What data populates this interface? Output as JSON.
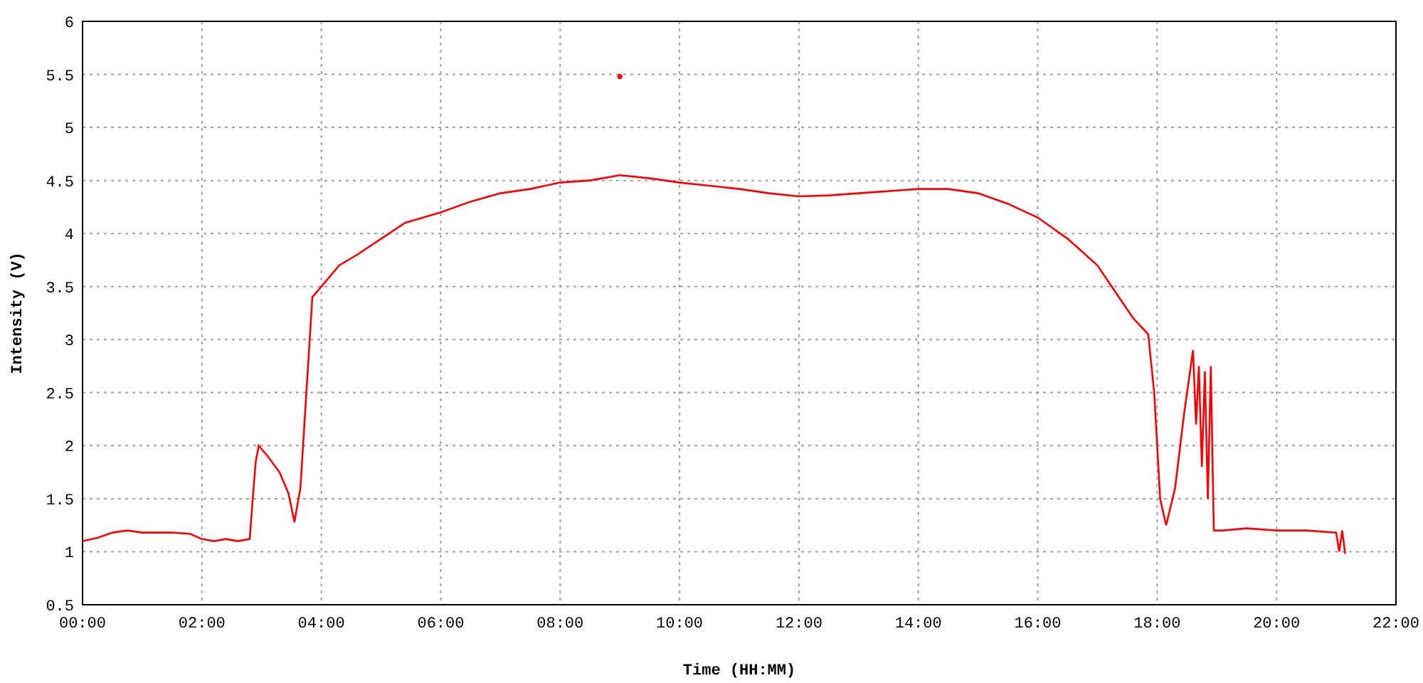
{
  "chart_data": {
    "type": "line",
    "grid": true,
    "xlabel": "Time (HH:MM)",
    "ylabel": "Intensity (V)",
    "xlim": [
      0,
      22
    ],
    "ylim": [
      0.5,
      6
    ],
    "xticks": [
      {
        "value": 0,
        "label": "00:00"
      },
      {
        "value": 2,
        "label": "02:00"
      },
      {
        "value": 4,
        "label": "04:00"
      },
      {
        "value": 6,
        "label": "06:00"
      },
      {
        "value": 8,
        "label": "08:00"
      },
      {
        "value": 10,
        "label": "10:00"
      },
      {
        "value": 12,
        "label": "12:00"
      },
      {
        "value": 14,
        "label": "14:00"
      },
      {
        "value": 16,
        "label": "16:00"
      },
      {
        "value": 18,
        "label": "18:00"
      },
      {
        "value": 20,
        "label": "20:00"
      },
      {
        "value": 22,
        "label": "22:00"
      }
    ],
    "yticks": [
      0.5,
      1,
      1.5,
      2,
      2.5,
      3,
      3.5,
      4,
      4.5,
      5,
      5.5,
      6
    ],
    "x": [
      0,
      0.25,
      0.5,
      0.75,
      1,
      1.5,
      1.8,
      2,
      2.2,
      2.4,
      2.6,
      2.8,
      2.85,
      2.9,
      2.95,
      3.1,
      3.3,
      3.45,
      3.55,
      3.65,
      3.75,
      3.85,
      4,
      4.3,
      4.6,
      5,
      5.4,
      6,
      6.5,
      7,
      7.5,
      8,
      8.5,
      9,
      9.5,
      10,
      10.5,
      11,
      11.5,
      12,
      12.5,
      13,
      13.5,
      14,
      14.5,
      15,
      15.5,
      16,
      16.5,
      17,
      17.3,
      17.6,
      17.85,
      17.95,
      18.05,
      18.15,
      18.3,
      18.45,
      18.6,
      18.65,
      18.7,
      18.75,
      18.8,
      18.85,
      18.9,
      18.95,
      19.1,
      19.5,
      20,
      20.5,
      21,
      21.05,
      21.1,
      21.15
    ],
    "series": [
      {
        "color": "#ff0000",
        "values": [
          1.1,
          1.13,
          1.18,
          1.2,
          1.18,
          1.18,
          1.17,
          1.12,
          1.1,
          1.12,
          1.1,
          1.12,
          1.5,
          1.85,
          2.0,
          1.9,
          1.75,
          1.55,
          1.28,
          1.6,
          2.5,
          3.4,
          3.5,
          3.7,
          3.8,
          3.95,
          4.1,
          4.2,
          4.3,
          4.38,
          4.42,
          4.48,
          4.5,
          4.55,
          4.52,
          4.48,
          4.45,
          4.42,
          4.38,
          4.35,
          4.36,
          4.38,
          4.4,
          4.42,
          4.42,
          4.38,
          4.28,
          4.15,
          3.95,
          3.7,
          3.45,
          3.2,
          3.05,
          2.5,
          1.5,
          1.25,
          1.6,
          2.3,
          2.9,
          2.2,
          2.75,
          1.8,
          2.7,
          1.5,
          2.75,
          1.2,
          1.2,
          1.22,
          1.2,
          1.2,
          1.18,
          1.0,
          1.2,
          0.98
        ]
      },
      {
        "color": "#ff0000",
        "marker": "dot",
        "values": [
          null,
          null,
          null,
          null,
          null,
          null,
          null,
          null,
          null,
          null,
          null,
          null,
          null,
          null,
          null,
          null,
          null,
          null,
          null,
          null,
          null,
          null,
          null,
          null,
          null,
          null,
          null,
          null,
          null,
          null,
          null,
          null,
          null,
          5.48,
          null,
          null,
          null,
          null,
          null,
          null,
          null,
          null,
          null,
          null,
          null,
          null,
          null,
          null,
          null,
          null,
          null,
          null,
          null,
          null,
          null,
          null,
          null,
          null,
          null,
          null,
          null,
          null,
          null,
          null,
          null,
          null,
          null,
          null,
          null,
          null,
          null,
          null,
          null,
          null
        ]
      }
    ]
  }
}
